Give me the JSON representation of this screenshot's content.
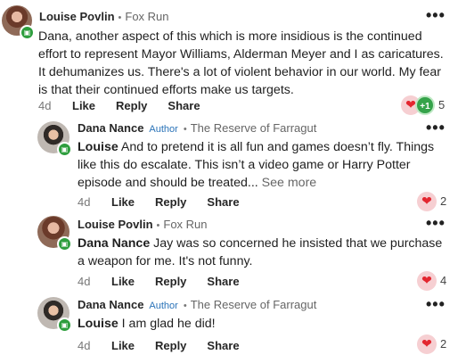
{
  "comments": [
    {
      "author": "Louise Povlin",
      "neighborhood": "Fox Run",
      "text": "Dana, another aspect of this which is more insidious is the continued effort to represent Mayor Williams, Alderman Meyer and I as caricatures.  It dehumanizes us. There's a lot of violent behavior in our world. My fear is that their continued efforts make us targets.",
      "age": "4d",
      "like": "Like",
      "reply": "Reply",
      "share": "Share",
      "reaction_count": "5",
      "reaction_plus": "+1"
    },
    {
      "author": "Dana Nance",
      "author_tag": "Author",
      "neighborhood": "The Reserve of Farragut",
      "mention": "Louise",
      "text": " And to pretend it is all fun and games doesn’t fly. Things like this do escalate. This isn’t a video game or Harry Potter episode and should be treated... ",
      "see_more": "See more",
      "age": "4d",
      "like": "Like",
      "reply": "Reply",
      "share": "Share",
      "reaction_count": "2"
    },
    {
      "author": "Louise Povlin",
      "neighborhood": "Fox Run",
      "mention": "Dana Nance",
      "text": " Jay was so concerned he insisted that we purchase a weapon for me.  It's not funny.",
      "age": "4d",
      "like": "Like",
      "reply": "Reply",
      "share": "Share",
      "reaction_count": "4"
    },
    {
      "author": "Dana Nance",
      "author_tag": "Author",
      "neighborhood": "The Reserve of Farragut",
      "mention": "Louise",
      "text": " I am glad he did!",
      "age": "4d",
      "like": "Like",
      "reply": "Reply",
      "share": "Share",
      "reaction_count": "2"
    }
  ],
  "separator": "•",
  "more_glyph": "•••",
  "heart_glyph": "❤",
  "colors": {
    "author_tag": "#2a73b8",
    "badge_green": "#2e9e3e",
    "heart_red": "#e3262f"
  },
  "icons": {
    "badge": "neighbor-badge-icon",
    "more": "more-options-icon",
    "heart": "heart-icon"
  }
}
